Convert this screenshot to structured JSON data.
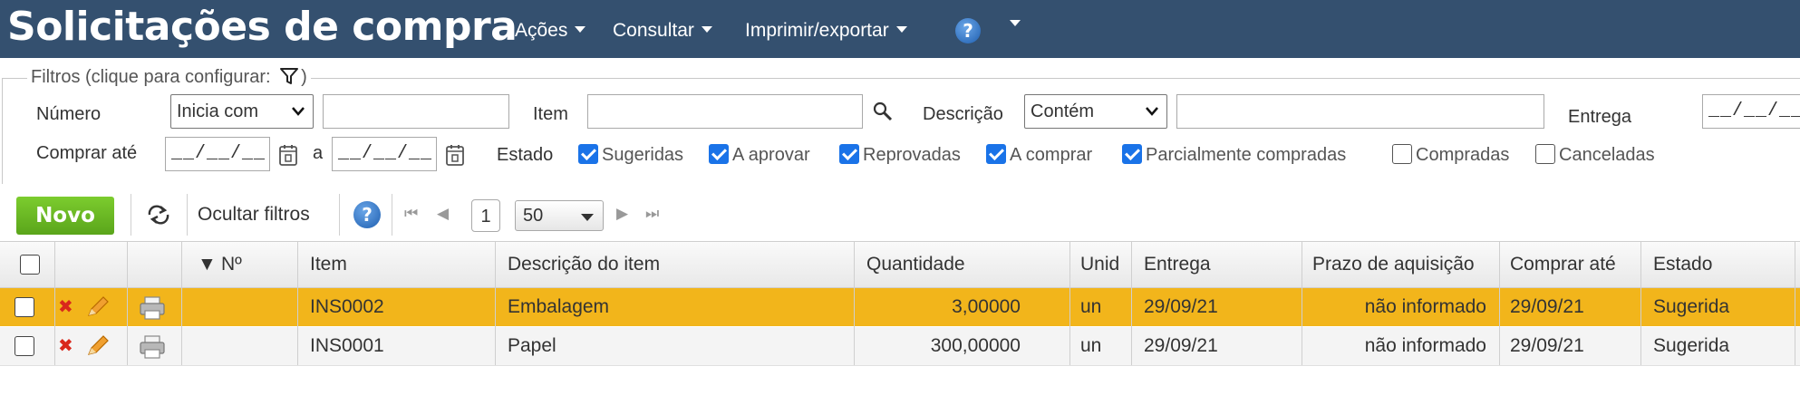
{
  "header": {
    "title": "Solicitações de compra",
    "menus": [
      "Ações",
      "Consultar",
      "Imprimir/exportar"
    ],
    "help_symbol": "?",
    "background_color": "#34506f"
  },
  "filters": {
    "legend": "Filtros (clique para configurar:",
    "legend_close": ")",
    "numero_label": "Número",
    "numero_mode": "Inicia com",
    "numero_value": "",
    "item_label": "Item",
    "item_value": "",
    "descricao_label": "Descrição",
    "descricao_mode": "Contém",
    "descricao_value": "",
    "entrega_label": "Entrega",
    "entrega_from": "__/__/__",
    "comprar_ate_label": "Comprar até",
    "comprar_ate_from": "__/__/__",
    "range_separator": "a",
    "comprar_ate_to": "__/__/__",
    "estado_label": "Estado",
    "estados": [
      {
        "label": "Sugeridas",
        "checked": true
      },
      {
        "label": "A aprovar",
        "checked": true
      },
      {
        "label": "Reprovadas",
        "checked": true
      },
      {
        "label": "A comprar",
        "checked": true
      },
      {
        "label": "Parcialmente compradas",
        "checked": true
      },
      {
        "label": "Compradas",
        "checked": false
      },
      {
        "label": "Canceladas",
        "checked": false
      }
    ],
    "checkbox_color": "#1a73e8"
  },
  "toolbar": {
    "new_label": "Novo",
    "new_color": "#6cb823",
    "hide_filters_label": "Ocultar filtros",
    "help_symbol": "?",
    "page": "1",
    "per_page": "50"
  },
  "table": {
    "columns": [
      "Nº",
      "Item",
      "Descrição do item",
      "Quantidade",
      "Unid",
      "Entrega",
      "Prazo de aquisição",
      "Comprar até",
      "Estado"
    ],
    "rows": [
      {
        "numero": "",
        "item": "INS0002",
        "descricao": "Embalagem",
        "quantidade": "3,00000",
        "unid": "un",
        "entrega": "29/09/21",
        "prazo": "não informado",
        "comprar_ate": "29/09/21",
        "estado": "Sugerida",
        "selected": true
      },
      {
        "numero": "",
        "item": "INS0001",
        "descricao": "Papel",
        "quantidade": "300,00000",
        "unid": "un",
        "entrega": "29/09/21",
        "prazo": "não informado",
        "comprar_ate": "29/09/21",
        "estado": "Sugerida",
        "selected": false
      }
    ],
    "selected_row_color": "#f2b51b"
  }
}
